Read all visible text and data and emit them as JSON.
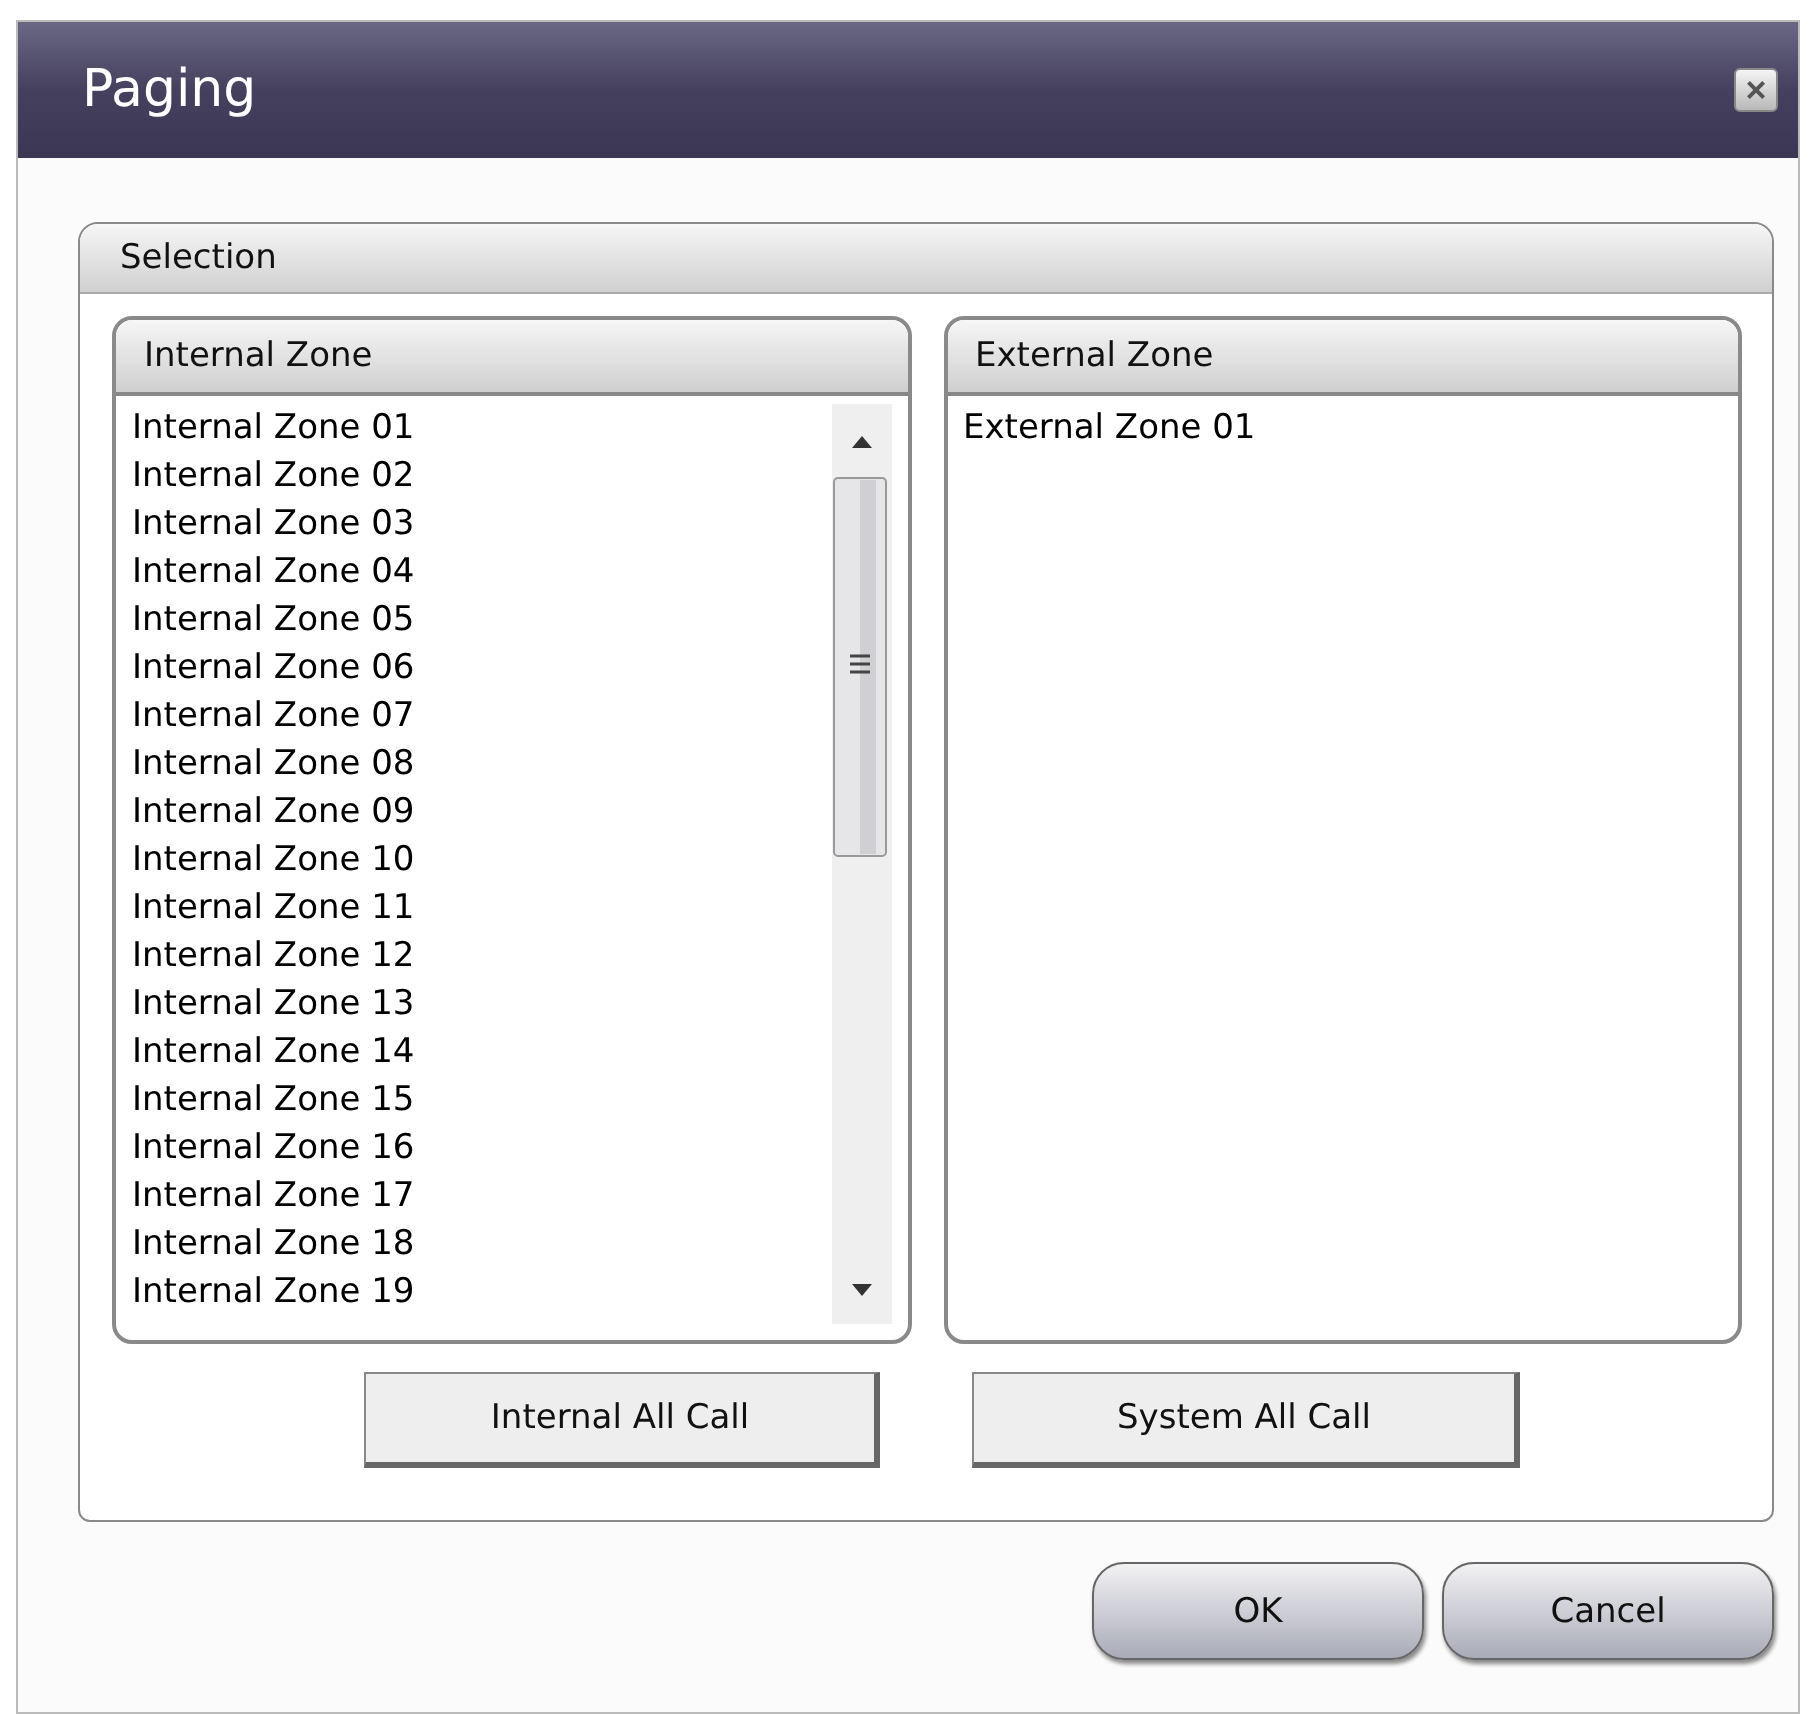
{
  "window": {
    "title": "Paging",
    "close": "×"
  },
  "selection": {
    "title": "Selection",
    "internal_zone": {
      "title": "Internal Zone",
      "items": [
        "Internal Zone 01",
        "Internal Zone 02",
        "Internal Zone 03",
        "Internal Zone 04",
        "Internal Zone 05",
        "Internal Zone 06",
        "Internal Zone 07",
        "Internal Zone 08",
        "Internal Zone 09",
        "Internal Zone 10",
        "Internal Zone 11",
        "Internal Zone 12",
        "Internal Zone 13",
        "Internal Zone 14",
        "Internal Zone 15",
        "Internal Zone 16",
        "Internal Zone 17",
        "Internal Zone 18",
        "Internal Zone 19"
      ]
    },
    "external_zone": {
      "title": "External Zone",
      "items": [
        "External Zone 01"
      ]
    },
    "buttons": [
      "Internal All Call",
      "System All Call"
    ]
  },
  "buttons": [
    "OK",
    "Cancel"
  ]
}
